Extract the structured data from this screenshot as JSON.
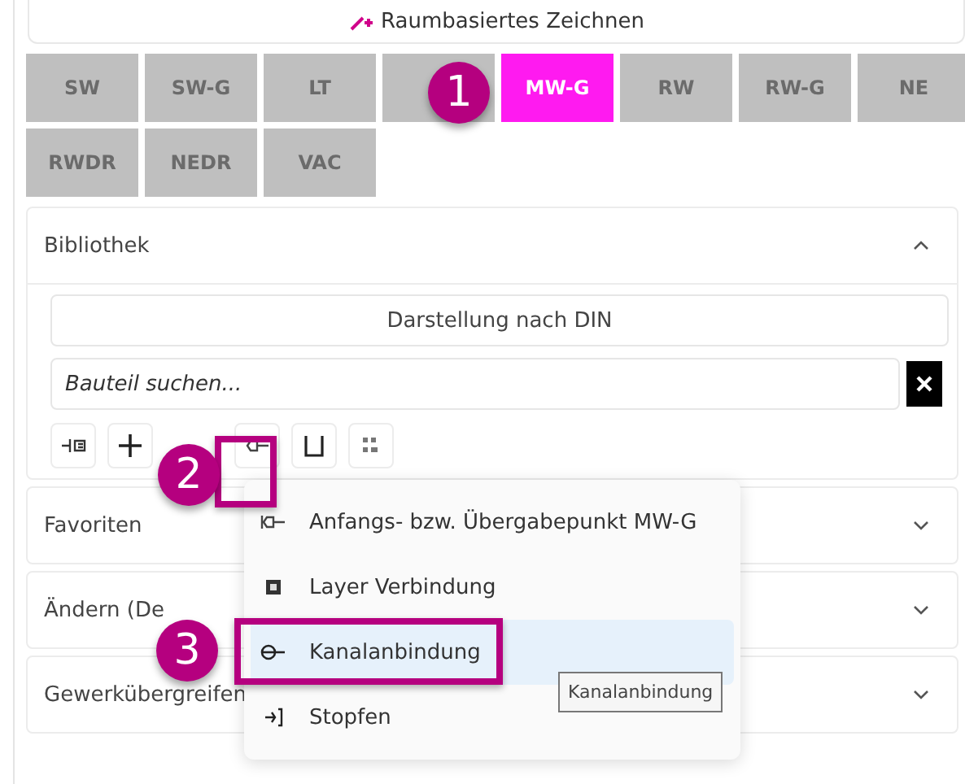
{
  "top_button": {
    "label": "Raumbasiertes Zeichnen"
  },
  "trade_tabs": [
    {
      "label": "SW",
      "selected": false
    },
    {
      "label": "SW-G",
      "selected": false
    },
    {
      "label": "LT",
      "selected": false
    },
    {
      "selected": false
    },
    {
      "label": "MW-G",
      "selected": true
    },
    {
      "label": "RW",
      "selected": false
    },
    {
      "label": "RW-G",
      "selected": false
    },
    {
      "label": "NE",
      "selected": false
    },
    {
      "label": "RWDR",
      "selected": false
    },
    {
      "label": "NEDR",
      "selected": false
    },
    {
      "label": "VAC",
      "selected": false
    }
  ],
  "library": {
    "title": "Bibliothek",
    "expanded": true,
    "display_button": "Darstellung nach DIN",
    "search": {
      "placeholder": "Bauteil suchen..."
    }
  },
  "sections": [
    {
      "title": "Favoriten",
      "expanded": false
    },
    {
      "title": "Ändern (De",
      "expanded": false
    },
    {
      "title": "Gewerkübergreifen",
      "expanded": false
    }
  ],
  "menu": [
    {
      "label": "Anfangs- bzw. Übergabepunkt MW-G",
      "selected": false
    },
    {
      "label": "Layer Verbindung",
      "selected": false
    },
    {
      "label": "Kanalanbindung",
      "selected": true
    },
    {
      "label": "Stopfen",
      "selected": false
    }
  ],
  "tooltip": "Kanalanbindung",
  "callouts": [
    "1",
    "2",
    "3"
  ]
}
